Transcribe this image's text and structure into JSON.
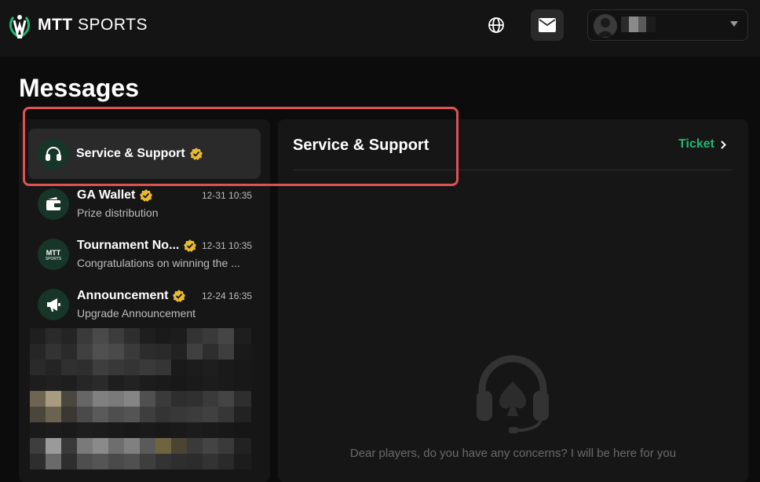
{
  "header": {
    "logo_bold": "MTT",
    "logo_rest": " SPORTS",
    "icons": {
      "globe": "globe-icon",
      "mail": "mail-icon",
      "user": "user-avatar-icon",
      "dropdown": "chevron-down-icon"
    }
  },
  "page": {
    "title": "Messages"
  },
  "conversations": [
    {
      "name": "Service & Support",
      "subtitle": "",
      "time": "",
      "icon": "headset-icon",
      "verified": true,
      "selected": true
    },
    {
      "name": "GA Wallet",
      "subtitle": "Prize distribution",
      "time": "12-31 10:35",
      "icon": "wallet-icon",
      "verified": true
    },
    {
      "name": "Tournament No...",
      "subtitle": "Congratulations on winning the ...",
      "time": "12-31 10:35",
      "icon": "mtt-sports-logo-icon",
      "verified": true
    },
    {
      "name": "Announcement",
      "subtitle": "Upgrade Announcement",
      "time": "12-24 16:35",
      "icon": "megaphone-icon",
      "verified": true
    }
  ],
  "chat": {
    "title": "Service & Support",
    "ticket_label": "Ticket",
    "empty_text": "Dear players, do you have any concerns? I will be here for you"
  },
  "colors": {
    "accent": "#1fb673",
    "verified": "#e8b931",
    "highlight": "#e05252"
  }
}
